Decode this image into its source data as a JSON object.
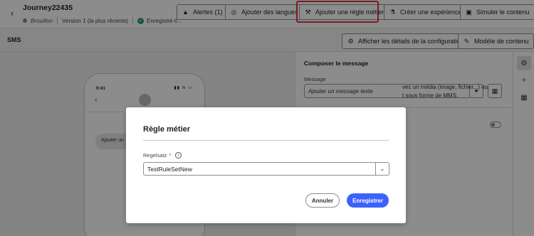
{
  "header": {
    "back_icon": "chevron-left-icon",
    "title": "Journey22435",
    "status": "Brouillon",
    "version": "Version 1 (la plus récente)",
    "saved": "Enregistré il...",
    "buttons": {
      "alerts": "Alertes (1)",
      "languages": "Ajouter des langues",
      "business_rule": "Ajouter une règle métier",
      "experiment": "Créer une expérience",
      "simulate": "Simuler le contenu"
    },
    "highlight_color": "#d7373f"
  },
  "subheader": {
    "channel": "SMS",
    "show_config": "Afficher les détails de la configuration",
    "content_template": "Modèle de contenu"
  },
  "preview": {
    "time": "9:41",
    "status_icons": "▮▮ ≋ ▭",
    "message_bubble": "Ajouter un"
  },
  "panel": {
    "title": "Composer le message",
    "message_label": "Message",
    "message_placeholder": "Ajouter un message texte",
    "mms_text_1": "vec un média (image, fichier...) ou",
    "mms_text_2": "t sous forme de MMS."
  },
  "rail": {
    "items": [
      "gear-icon",
      "magic-wand-icon",
      "blocks-icon"
    ]
  },
  "modal": {
    "title": "Règle métier",
    "field_label": "Regelsatz",
    "required_mark": "*",
    "info_glyph": "i",
    "selected_value": "TestRuleSetNew",
    "cancel": "Annuler",
    "save": "Enregistrer",
    "accent_color": "#3b63fb"
  }
}
